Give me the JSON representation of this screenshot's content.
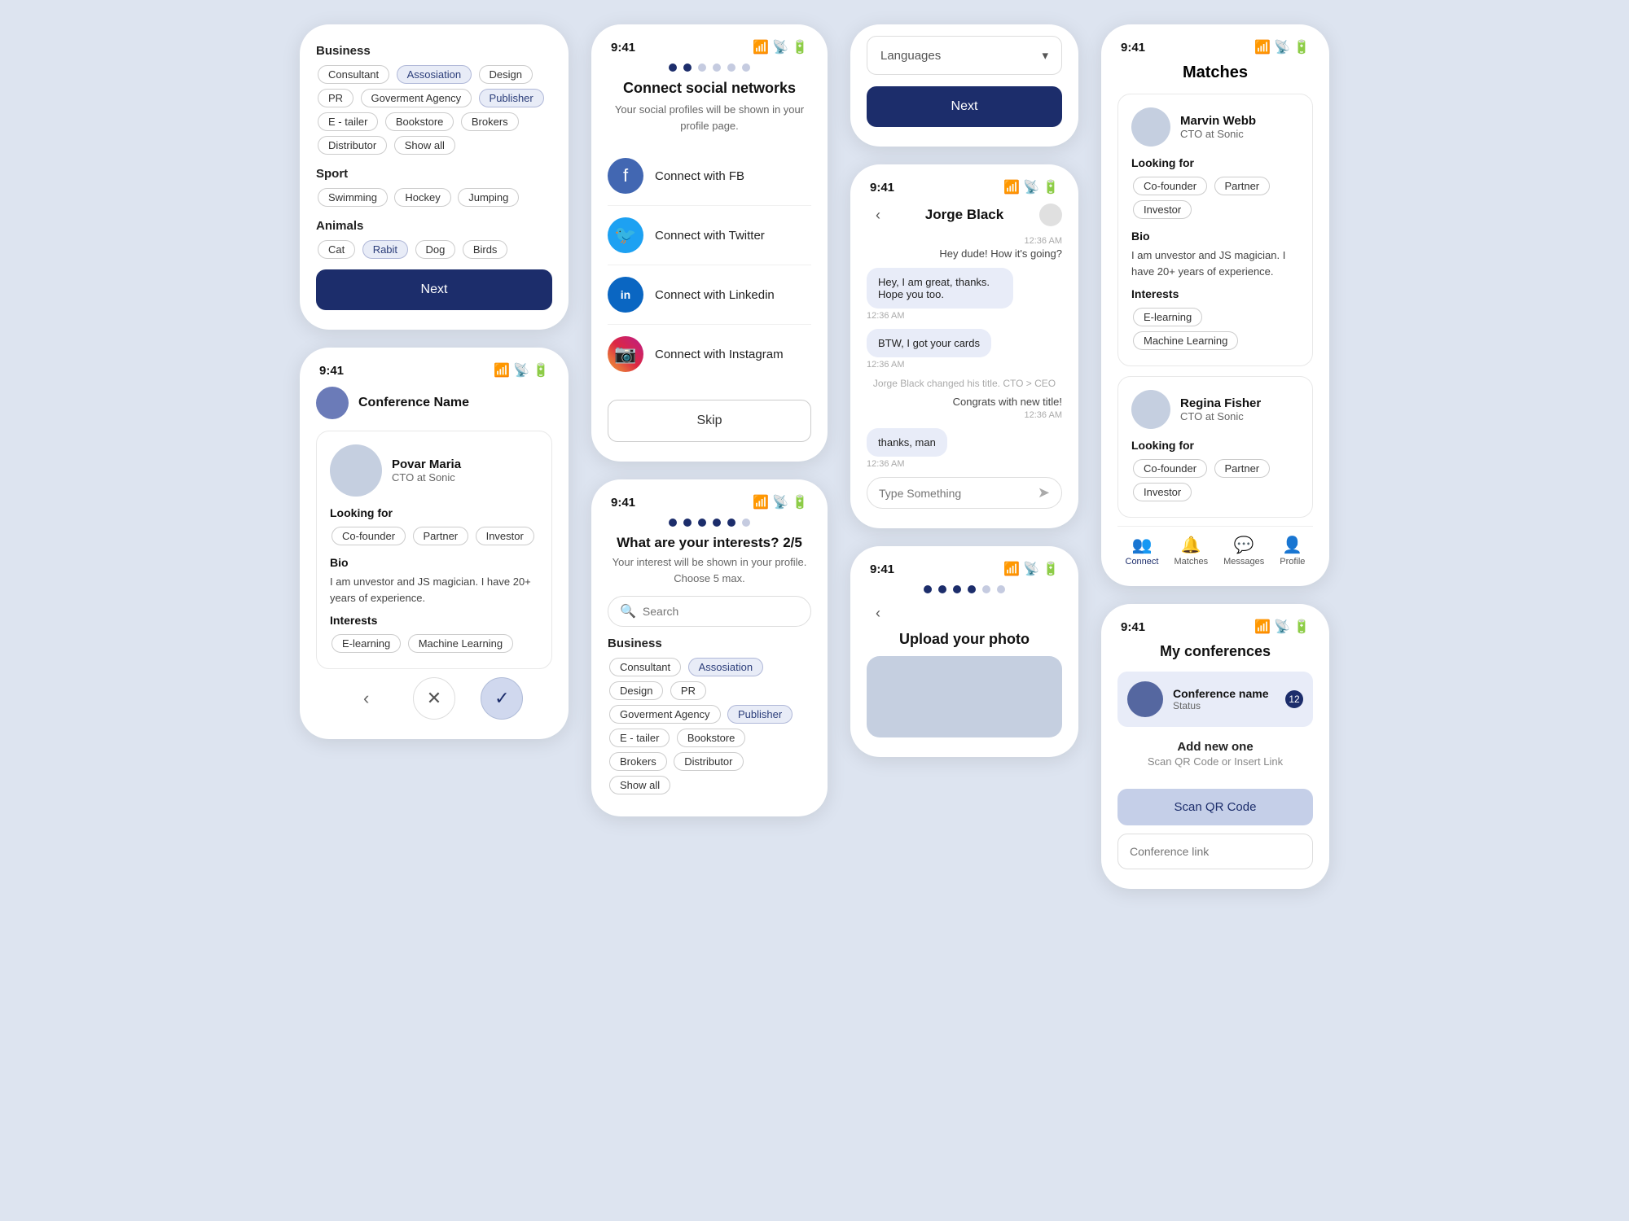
{
  "colors": {
    "primary": "#1c2d6b",
    "bg": "#dde4f0",
    "tagSelected": "#e8ecf7",
    "bubble": "#e8ecf8"
  },
  "screen1": {
    "sections": [
      {
        "label": "Business",
        "tags": [
          {
            "text": "Consultant",
            "selected": false
          },
          {
            "text": "Assosiation",
            "selected": true
          },
          {
            "text": "Design",
            "selected": false
          },
          {
            "text": "PR",
            "selected": false
          },
          {
            "text": "Goverment Agency",
            "selected": false
          },
          {
            "text": "Publisher",
            "selected": true
          },
          {
            "text": "E - tailer",
            "selected": false
          },
          {
            "text": "Bookstore",
            "selected": false
          },
          {
            "text": "Brokers",
            "selected": false
          },
          {
            "text": "Distributor",
            "selected": false
          },
          {
            "text": "Show all",
            "selected": false
          }
        ]
      },
      {
        "label": "Sport",
        "tags": [
          {
            "text": "Swimming",
            "selected": false
          },
          {
            "text": "Hockey",
            "selected": false
          },
          {
            "text": "Jumping",
            "selected": false
          }
        ]
      },
      {
        "label": "Animals",
        "tags": [
          {
            "text": "Cat",
            "selected": false
          },
          {
            "text": "Rabit",
            "selected": true
          },
          {
            "text": "Dog",
            "selected": false
          },
          {
            "text": "Birds",
            "selected": false
          }
        ]
      }
    ],
    "next_label": "Next"
  },
  "screen2": {
    "time": "9:41",
    "dots": [
      true,
      true,
      false,
      false,
      false,
      false
    ],
    "title": "Connect social networks",
    "subtitle": "Your social profiles will be shown\nin your profile page.",
    "socials": [
      {
        "label": "Connect with FB",
        "type": "fb"
      },
      {
        "label": "Connect with Twitter",
        "type": "tw"
      },
      {
        "label": "Connect with Linkedin",
        "type": "li"
      },
      {
        "label": "Connect with Instagram",
        "type": "ig"
      }
    ],
    "skip_label": "Skip"
  },
  "screen3": {
    "time": "9:41",
    "conference_avatar": "",
    "conference_name": "Conference Name",
    "profile": {
      "name": "Povar Maria",
      "title": "CTO at Sonic",
      "looking_for_label": "Looking for",
      "looking_for_tags": [
        "Co-founder",
        "Partner",
        "Investor"
      ],
      "bio_label": "Bio",
      "bio_text": "I am unvestor and JS magician. I have 20+ years of experience.",
      "interests_label": "Interests",
      "interests_tags": [
        "E-learning",
        "Machine Learning"
      ]
    },
    "actions": {
      "back_icon": "‹",
      "reject_icon": "✕",
      "accept_icon": "✓"
    }
  },
  "screen4": {
    "time": "9:41",
    "dots": [
      true,
      true,
      true,
      true,
      true,
      false
    ],
    "title": "What are your interests?",
    "title_count": "2/5",
    "subtitle": "Your interest will be shown in your\nprofile. Choose 5 max.",
    "search_placeholder": "Search",
    "sections": [
      {
        "label": "Business",
        "tags": [
          {
            "text": "Consultant",
            "selected": false
          },
          {
            "text": "Assosiation",
            "selected": true
          },
          {
            "text": "Design",
            "selected": false
          },
          {
            "text": "PR",
            "selected": false
          },
          {
            "text": "Goverment Agency",
            "selected": false
          },
          {
            "text": "Publisher",
            "selected": true
          },
          {
            "text": "E - tailer",
            "selected": false
          },
          {
            "text": "Bookstore",
            "selected": false
          },
          {
            "text": "Brokers",
            "selected": false
          },
          {
            "text": "Distributor",
            "selected": false
          },
          {
            "text": "Show all",
            "selected": false
          }
        ]
      }
    ]
  },
  "screen5": {
    "time": "9:41",
    "chat_title": "Jorge Black",
    "messages": [
      {
        "text": "Hey dude! How it's going?",
        "side": "right",
        "time": "12:36 AM",
        "bubble": false
      },
      {
        "text": "Hey, I am great, thanks. Hope you too.",
        "side": "left",
        "time": "12:36 AM",
        "bubble": true
      },
      {
        "text": "BTW, I got your cards",
        "side": "left",
        "time": "12:36 AM",
        "bubble": true
      },
      {
        "system": "Jorge Black changed his title. CTO > CEO"
      },
      {
        "text": "Congrats with new title!",
        "side": "right",
        "time": "12:36 AM",
        "bubble": false
      },
      {
        "text": "thanks, man",
        "side": "left",
        "time": "12:36 AM",
        "bubble": true
      }
    ],
    "input_placeholder": "Type Something"
  },
  "screen6": {
    "time": "9:41",
    "dots": [
      true,
      true,
      true,
      false,
      false,
      false
    ],
    "languages_placeholder": "Languages",
    "next_label": "Next"
  },
  "screen7": {
    "time": "9:41",
    "dots": [
      true,
      true,
      true,
      true,
      false,
      false
    ],
    "title": "Upload your photo",
    "title_dots": [
      true,
      true,
      true,
      true,
      false,
      false
    ]
  },
  "screen8": {
    "time": "9:41",
    "title": "Matches",
    "matches": [
      {
        "name": "Marvin Webb",
        "title": "CTO at Sonic",
        "looking_for_label": "Looking for",
        "looking_for_tags": [
          "Co-founder",
          "Partner",
          "Investor"
        ],
        "bio_label": "Bio",
        "bio_text": "I am unvestor and JS magician. I have 20+ years of experience.",
        "interests_label": "Interests",
        "interests_tags": [
          "E-learning",
          "Machine Learning"
        ]
      },
      {
        "name": "Regina Fisher",
        "title": "CTO at Sonic",
        "looking_for_label": "Looking for",
        "looking_for_tags": [
          "Co-founder",
          "Partner",
          "Investor"
        ]
      }
    ],
    "nav": [
      {
        "icon": "👥",
        "label": "Connect",
        "active": true
      },
      {
        "icon": "💬",
        "label": "Matches",
        "active": false
      },
      {
        "icon": "✉️",
        "label": "Messages",
        "active": false
      },
      {
        "icon": "👤",
        "label": "Profile",
        "active": false
      }
    ]
  },
  "screen9": {
    "time": "9:41",
    "title": "My conferences",
    "conference": {
      "name": "Conference name",
      "status": "Status",
      "badge": "12"
    },
    "add_new_title": "Add new one",
    "add_new_sub": "Scan QR Code or Insert Link",
    "scan_btn": "Scan QR Code",
    "conf_link_placeholder": "Conference link"
  }
}
